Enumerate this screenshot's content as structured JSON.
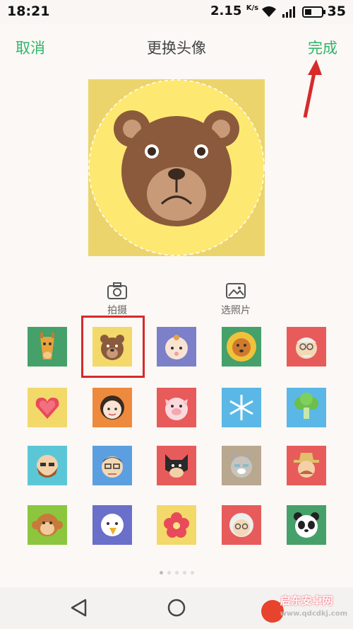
{
  "status": {
    "time": "18:21",
    "speed": "2.15",
    "speed_unit": "K/s",
    "battery": "35"
  },
  "header": {
    "cancel": "取消",
    "title": "更换头像",
    "done": "完成"
  },
  "actions": {
    "camera": "拍摄",
    "gallery": "选照片"
  },
  "avatars": [
    [
      "giraffe",
      "bear",
      "baby",
      "lion",
      "old-man"
    ],
    [
      "heart",
      "woman",
      "pig",
      "snowflake",
      "broccoli"
    ],
    [
      "bearded-man",
      "glasses-man",
      "batman",
      "cat",
      "cowboy"
    ],
    [
      "monkey",
      "eagle",
      "flower",
      "grandma",
      "panda"
    ]
  ],
  "selected_avatar": "bear",
  "pager": {
    "pages": 5,
    "current": 1
  },
  "watermark": {
    "name": "启东安卓网",
    "site": "www.qdcdkj.com"
  }
}
